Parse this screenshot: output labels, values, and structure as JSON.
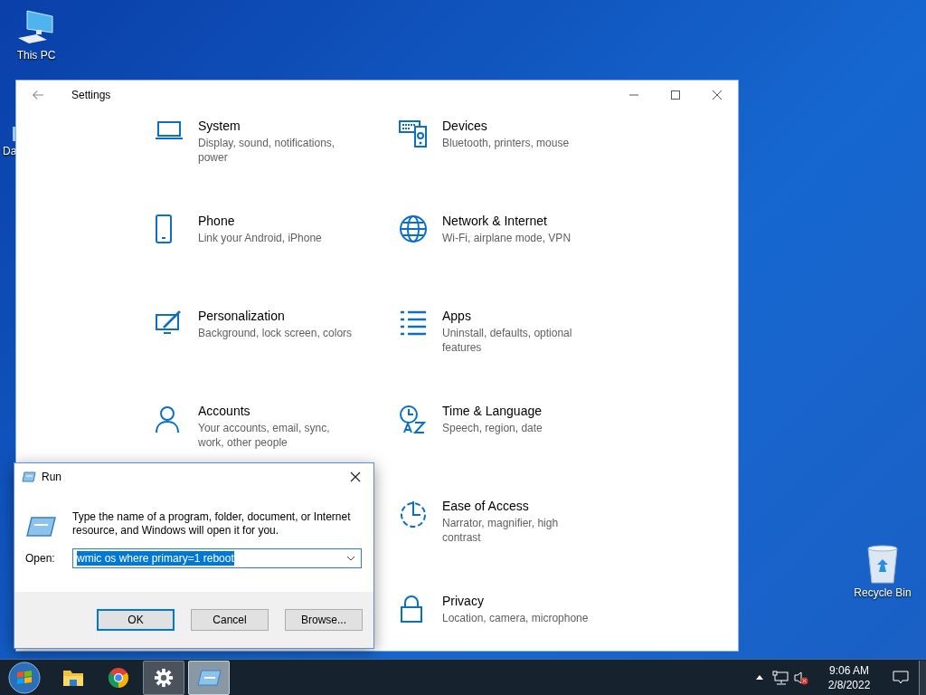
{
  "desktop_icons": [
    {
      "label": "This PC"
    },
    {
      "label": "Da"
    },
    {
      "label": "Recycle Bin"
    }
  ],
  "settings_window": {
    "title": "Settings",
    "columns": [
      [
        {
          "title": "System",
          "description": "Display, sound, notifications, power"
        },
        {
          "title": "Phone",
          "description": "Link your Android, iPhone"
        },
        {
          "title": "Personalization",
          "description": "Background, lock screen, colors"
        },
        {
          "title": "Accounts",
          "description": "Your accounts, email, sync, work, other people"
        }
      ],
      [
        {
          "title": "Devices",
          "description": "Bluetooth, printers, mouse"
        },
        {
          "title": "Network & Internet",
          "description": "Wi-Fi, airplane mode, VPN"
        },
        {
          "title": "Apps",
          "description": "Uninstall, defaults, optional features"
        },
        {
          "title": "Time & Language",
          "description": "Speech, region, date"
        },
        {
          "title": "Ease of Access",
          "description": "Narrator, magnifier, high contrast"
        },
        {
          "title": "Privacy",
          "description": "Location, camera, microphone"
        }
      ]
    ]
  },
  "run_dialog": {
    "title": "Run",
    "message": "Type the name of a program, folder, document, or Internet resource, and Windows will open it for you.",
    "open_label": "Open:",
    "value": "wmic os where primary=1 reboot",
    "value_selected": true,
    "buttons": [
      {
        "label": "OK",
        "default": true
      },
      {
        "label": "Cancel",
        "default": false
      },
      {
        "label": "Browse...",
        "default": false
      }
    ]
  },
  "taskbar": {
    "apps": [
      {
        "open": false,
        "active": false
      },
      {
        "open": false,
        "active": false
      },
      {
        "open": false,
        "active": false
      },
      {
        "open": true,
        "active": false
      },
      {
        "open": true,
        "active": true
      }
    ],
    "time": "9:06 AM",
    "date": "2/8/2022"
  }
}
